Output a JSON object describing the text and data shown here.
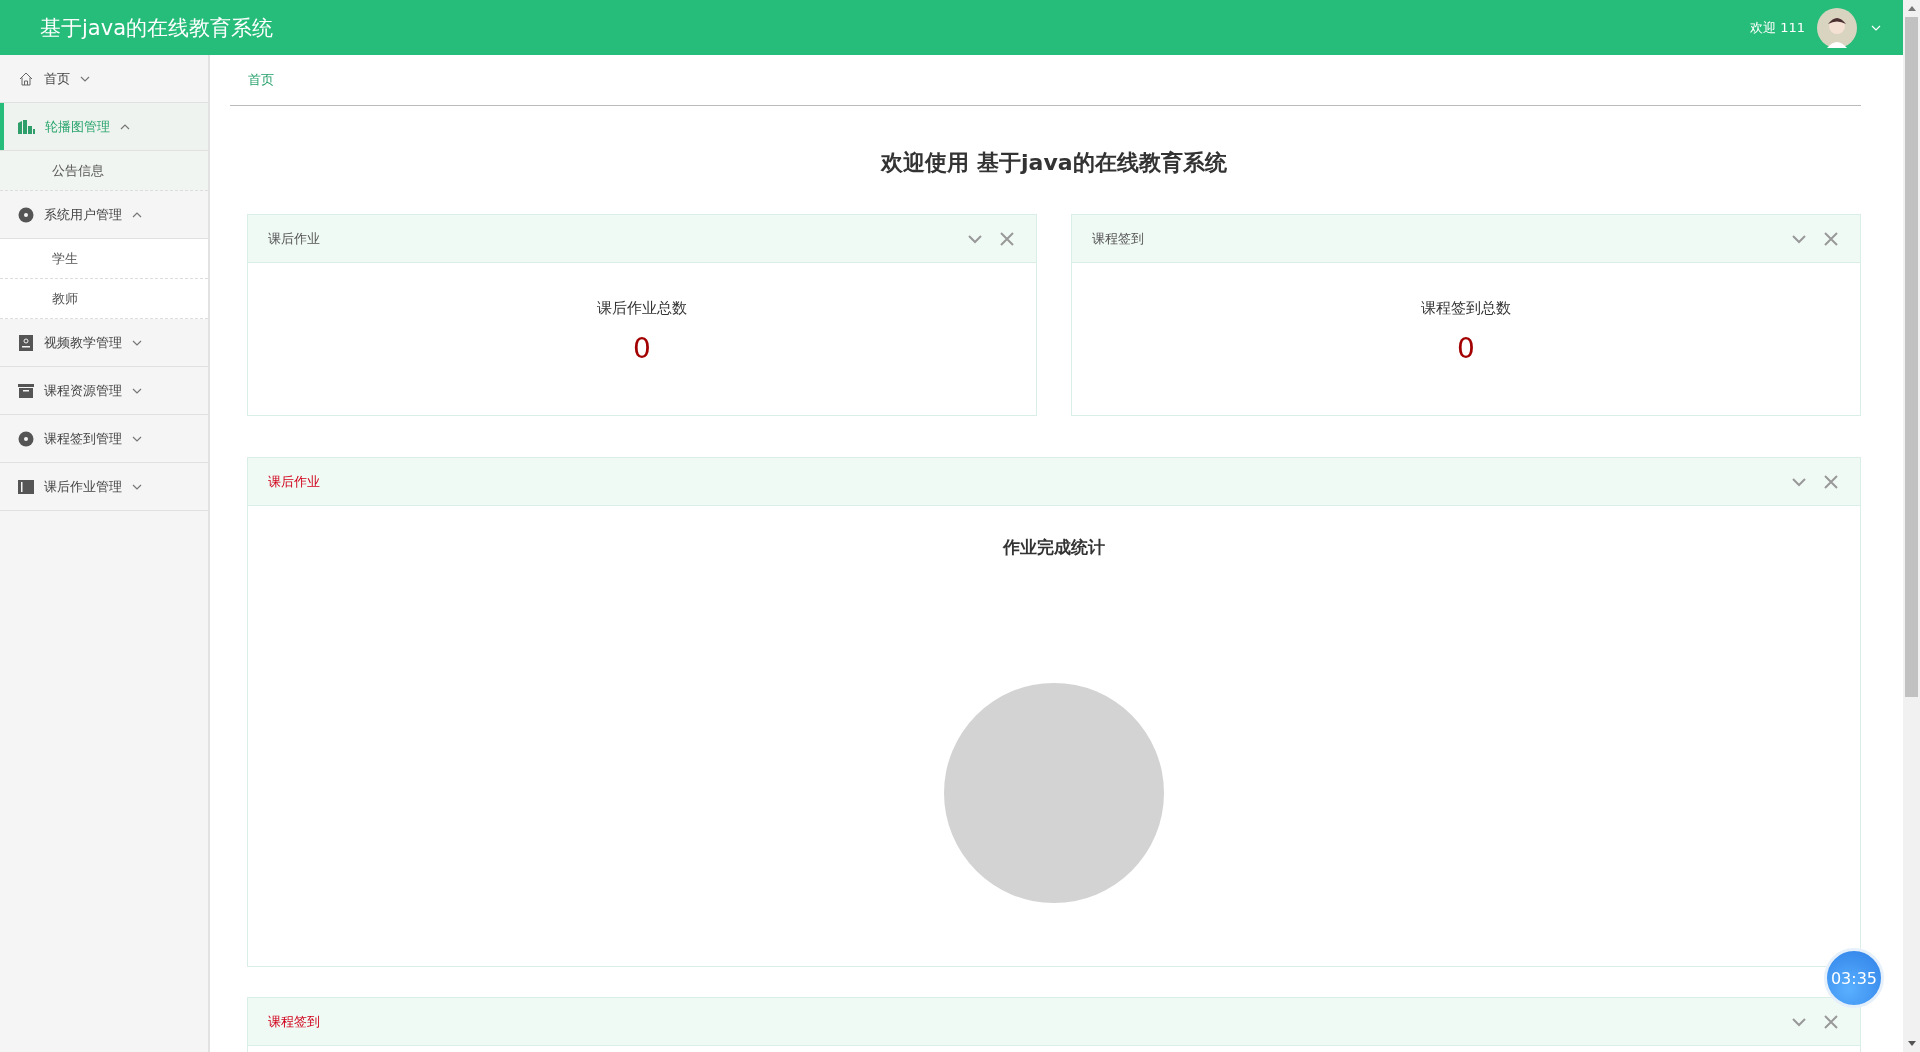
{
  "header": {
    "title": "基于java的在线教育系统",
    "greeting": "欢迎 111"
  },
  "sidebar": {
    "items": [
      {
        "label": "首页",
        "expanded": false,
        "selected": false
      },
      {
        "label": "轮播图管理",
        "expanded": true,
        "selected": true,
        "children": [
          {
            "label": "公告信息",
            "hovered": true
          }
        ]
      },
      {
        "label": "系统用户管理",
        "expanded": true,
        "selected": false,
        "children": [
          {
            "label": "学生",
            "hovered": false
          },
          {
            "label": "教师",
            "hovered": false
          }
        ]
      },
      {
        "label": "视频教学管理",
        "expanded": false,
        "selected": false
      },
      {
        "label": "课程资源管理",
        "expanded": false,
        "selected": false
      },
      {
        "label": "课程签到管理",
        "expanded": false,
        "selected": false
      },
      {
        "label": "课后作业管理",
        "expanded": false,
        "selected": false
      }
    ]
  },
  "breadcrumb": [
    "首页"
  ],
  "page_title": "欢迎使用 基于java的在线教育系统",
  "stat_cards": [
    {
      "title": "课后作业",
      "label": "课后作业总数",
      "value": "0"
    },
    {
      "title": "课程签到",
      "label": "课程签到总数",
      "value": "0"
    }
  ],
  "panels": [
    {
      "title": "课后作业",
      "chart_title": "作业完成统计"
    },
    {
      "title": "课程签到"
    }
  ],
  "timer": "03:35"
}
